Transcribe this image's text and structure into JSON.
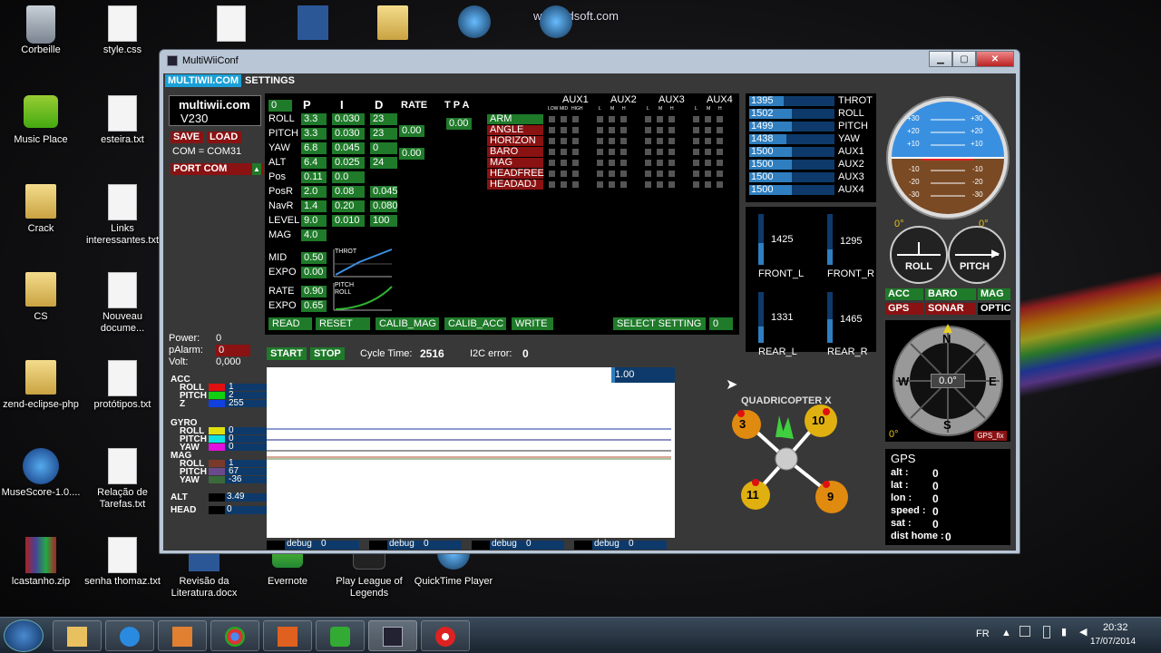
{
  "desktop": {
    "watermark": "www.zdsoft.com",
    "icons": [
      {
        "label": "Corbeille",
        "icon": "recycle-bin-icon"
      },
      {
        "label": "style.css",
        "icon": "css-file-icon"
      },
      {
        "label": "Music Place",
        "icon": "music-icon"
      },
      {
        "label": "esteira.txt",
        "icon": "text-file-icon"
      },
      {
        "label": "Crack",
        "icon": "folder-icon"
      },
      {
        "label": "Links interessantes.txt",
        "icon": "text-file-icon"
      },
      {
        "label": "CS",
        "icon": "folder-icon"
      },
      {
        "label": "Nouveau docume...",
        "icon": "text-file-icon"
      },
      {
        "label": "zend-eclipse-php",
        "icon": "folder-icon"
      },
      {
        "label": "protótipos.txt",
        "icon": "text-file-icon"
      },
      {
        "label": "MuseScore-1.0....",
        "icon": "musescore-icon"
      },
      {
        "label": "Relação de Tarefas.txt",
        "icon": "text-file-icon"
      },
      {
        "label": "lcastanho.zip",
        "icon": "winrar-icon"
      },
      {
        "label": "senha thomaz.txt",
        "icon": "text-file-icon"
      },
      {
        "label": "Revisão da Literatura.docx",
        "icon": "word-icon"
      },
      {
        "label": "Evernote",
        "icon": "evernote-icon"
      },
      {
        "label": "Play League of Legends",
        "icon": "lol-icon"
      },
      {
        "label": "QuickTime Player",
        "icon": "quicktime-icon"
      }
    ]
  },
  "window": {
    "title": "MultiWiiConf",
    "menu": {
      "tab1": "MULTIWII.COM",
      "tab2": "SETTINGS"
    },
    "brand": {
      "name": "multiwii.com",
      "version": "V230"
    },
    "buttons": {
      "save": "SAVE",
      "load": "LOAD",
      "com": "COM = COM31",
      "port": "PORT COM"
    },
    "status": {
      "power_label": "Power:",
      "power": "0",
      "palarm_label": "pAlarm:",
      "palarm": "0",
      "volt_label": "Volt:",
      "volt": "0,000"
    },
    "pid": {
      "header_idx": "0",
      "col_p": "P",
      "col_i": "I",
      "col_d": "D",
      "col_rate": "RATE",
      "col_tpa": "T P A",
      "rows": [
        {
          "name": "ROLL",
          "p": "3.3",
          "i": "0.030",
          "d": "23"
        },
        {
          "name": "PITCH",
          "p": "3.3",
          "i": "0.030",
          "d": "23"
        },
        {
          "name": "YAW",
          "p": "6.8",
          "i": "0.045",
          "d": "0"
        },
        {
          "name": "ALT",
          "p": "6.4",
          "i": "0.025",
          "d": "24"
        },
        {
          "name": "Pos",
          "p": "0.11",
          "i": "0.0",
          "d": ""
        },
        {
          "name": "PosR",
          "p": "2.0",
          "i": "0.08",
          "d": "0.045"
        },
        {
          "name": "NavR",
          "p": "1.4",
          "i": "0.20",
          "d": "0.080"
        },
        {
          "name": "LEVEL",
          "p": "9.0",
          "i": "0.010",
          "d": "100"
        },
        {
          "name": "MAG",
          "p": "4.0",
          "i": "",
          "d": ""
        }
      ],
      "rate_rp": "0.00",
      "rate_yaw": "0.00",
      "tpa": "0.00",
      "mid_label": "MID",
      "mid": "0.50",
      "expo_label": "EXPO",
      "expo": "0.00",
      "rate_label": "RATE",
      "rate": "0.90",
      "expo2_label": "EXPO",
      "expo2": "0.65",
      "throt_label": "THROT",
      "pr_label1": "PITCH",
      "pr_label2": "ROLL"
    },
    "actions": {
      "read": "READ",
      "reset": "RESET",
      "calib_mag": "CALIB_MAG",
      "calib_acc": "CALIB_ACC",
      "write": "WRITE",
      "select": "SELECT SETTING",
      "select_val": "0"
    },
    "aux": {
      "headers": [
        "AUX1",
        "AUX2",
        "AUX3",
        "AUX4"
      ],
      "sub1": [
        "LOW",
        "MID",
        "HIGH"
      ],
      "sub": [
        "L",
        "M",
        "H"
      ],
      "modes": [
        {
          "name": "ARM",
          "active": true
        },
        {
          "name": "ANGLE",
          "active": false
        },
        {
          "name": "HORIZON",
          "active": false
        },
        {
          "name": "BARO",
          "active": false
        },
        {
          "name": "MAG",
          "active": false
        },
        {
          "name": "HEADFREE",
          "active": false
        },
        {
          "name": "HEADADJ",
          "active": false
        }
      ]
    },
    "rc": [
      {
        "value": "1395",
        "name": "THROT",
        "level": 0.4
      },
      {
        "value": "1502",
        "name": "ROLL",
        "level": 0.5
      },
      {
        "value": "1499",
        "name": "PITCH",
        "level": 0.5
      },
      {
        "value": "1438",
        "name": "YAW",
        "level": 0.44
      },
      {
        "value": "1500",
        "name": "AUX1",
        "level": 0.5
      },
      {
        "value": "1500",
        "name": "AUX2",
        "level": 0.5
      },
      {
        "value": "1500",
        "name": "AUX3",
        "level": 0.5
      },
      {
        "value": "1500",
        "name": "AUX4",
        "level": 0.5
      }
    ],
    "motors": [
      {
        "value": "1425",
        "name": "FRONT_L",
        "level": 0.43
      },
      {
        "value": "1295",
        "name": "FRONT_R",
        "level": 0.3
      },
      {
        "value": "1331",
        "name": "REAR_L",
        "level": 0.33
      },
      {
        "value": "1465",
        "name": "REAR_R",
        "level": 0.47
      }
    ],
    "horizon": {
      "ticks_pos": [
        "+30",
        "+20",
        "+10"
      ],
      "ticks_neg": [
        "-10",
        "-20",
        "-30"
      ],
      "roll_deg": "0°",
      "pitch_deg": "0°",
      "roll_label": "ROLL",
      "pitch_label": "PITCH"
    },
    "sensors": {
      "acc": "ACC",
      "baro": "BARO",
      "mag": "MAG",
      "gps": "GPS",
      "sonar": "SONAR",
      "optic": "OPTIC"
    },
    "compass": {
      "n": "N",
      "s": "S",
      "e": "E",
      "w": "W",
      "heading": "0.0°",
      "alt_deg": "0°",
      "gps_fix": "GPS_fix"
    },
    "gps": {
      "title": "GPS",
      "rows": [
        {
          "label": "alt :",
          "value": "0"
        },
        {
          "label": "lat :",
          "value": "0"
        },
        {
          "label": "lon :",
          "value": "0"
        },
        {
          "label": "speed :",
          "value": "0"
        },
        {
          "label": "sat :",
          "value": "0"
        },
        {
          "label": "dist home :",
          "value": "0"
        }
      ]
    },
    "graph": {
      "start": "START",
      "stop": "STOP",
      "cycle_label": "Cycle Time:",
      "cycle": "2516",
      "i2c_label": "I2C error:",
      "i2c": "0",
      "scale": "1.00",
      "debug": [
        {
          "label": "debug",
          "value": "0"
        },
        {
          "label": "debug",
          "value": "0"
        },
        {
          "label": "debug",
          "value": "0"
        },
        {
          "label": "debug",
          "value": "0"
        }
      ]
    },
    "sensor_values": {
      "acc_label": "ACC",
      "acc": [
        {
          "axis": "ROLL",
          "value": "1",
          "color": "#e01010"
        },
        {
          "axis": "PITCH",
          "value": "2",
          "color": "#10d010"
        },
        {
          "axis": "Z",
          "value": "255",
          "color": "#1040e0"
        }
      ],
      "gyro_label": "GYRO",
      "gyro": [
        {
          "axis": "ROLL",
          "value": "0",
          "color": "#e0e010"
        },
        {
          "axis": "PITCH",
          "value": "0",
          "color": "#10e0e0"
        },
        {
          "axis": "YAW",
          "value": "0",
          "color": "#e010e0"
        }
      ],
      "mag_label": "MAG",
      "mag": [
        {
          "axis": "ROLL",
          "value": "1",
          "color": "#7a3a2a"
        },
        {
          "axis": "PITCH",
          "value": "67",
          "color": "#6a4a8a"
        },
        {
          "axis": "YAW",
          "value": "-36",
          "color": "#3a6a3a"
        }
      ],
      "alt_label": "ALT",
      "alt": "3.49",
      "head_label": "HEAD",
      "head": "0"
    },
    "quad": {
      "label": "QUADRICOPTER X",
      "m_fl": "3",
      "m_fr": "10",
      "m_rl": "11",
      "m_rr": "9"
    }
  },
  "taskbar": {
    "lang": "FR",
    "time": "20:32",
    "date": "17/07/2014"
  }
}
